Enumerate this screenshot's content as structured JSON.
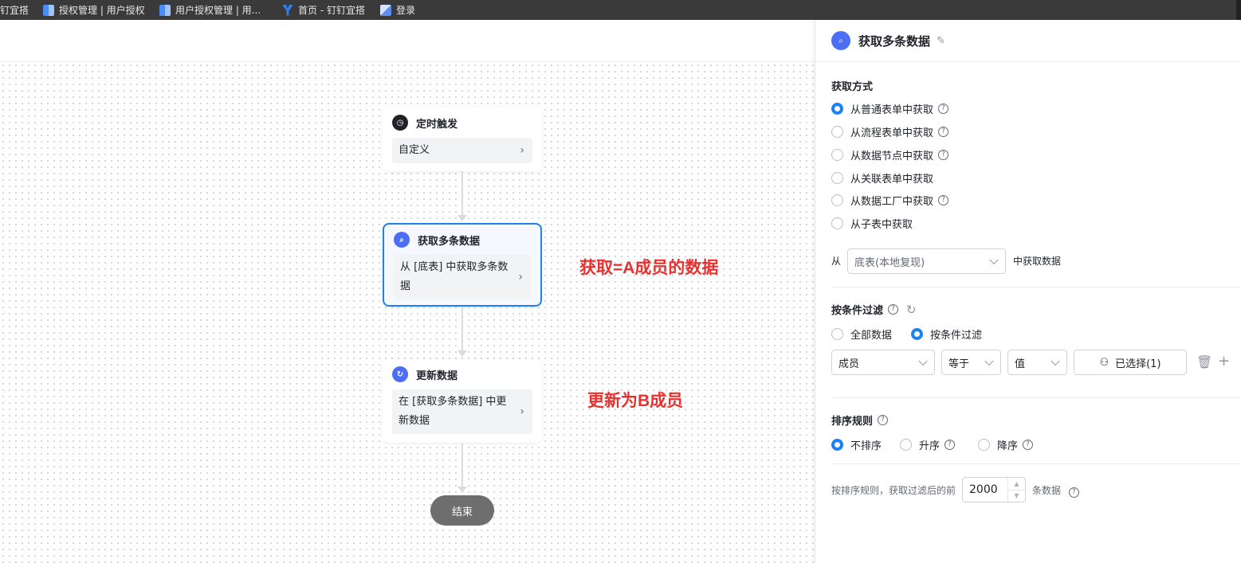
{
  "bookmarks": [
    {
      "label": "钉宜搭",
      "icon": "none"
    },
    {
      "label": "授权管理 | 用户授权",
      "icon": "grid-icon"
    },
    {
      "label": "用户授权管理 | 用...",
      "icon": "grid-icon"
    },
    {
      "label": "首页 - 钉钉宜搭",
      "icon": "yida-icon"
    },
    {
      "label": "登录",
      "icon": "app-icon"
    }
  ],
  "flow": {
    "trigger": {
      "title": "定时触发",
      "body": "自定义",
      "icon": "clock-icon"
    },
    "fetch": {
      "title": "获取多条数据",
      "body": "从 [底表] 中获取多条数据",
      "icon": "search-data-icon"
    },
    "update": {
      "title": "更新数据",
      "body": "在 [获取多条数据] 中更新数据",
      "icon": "refresh-data-icon"
    },
    "end_label": "结束"
  },
  "annotations": {
    "fetch_note": "获取=A成员的数据",
    "update_note": "更新为B成员"
  },
  "panel": {
    "title": "获取多条数据",
    "fetch_method": {
      "label": "获取方式",
      "options": [
        {
          "label": "从普通表单中获取",
          "selected": true,
          "help": true
        },
        {
          "label": "从流程表单中获取",
          "selected": false,
          "help": true
        },
        {
          "label": "从数据节点中获取",
          "selected": false,
          "help": true
        },
        {
          "label": "从关联表单中获取",
          "selected": false,
          "help": false
        },
        {
          "label": "从数据工厂中获取",
          "selected": false,
          "help": true
        },
        {
          "label": "从子表中获取",
          "selected": false,
          "help": false
        }
      ]
    },
    "source": {
      "prefix": "从",
      "value": "底表(本地复现)",
      "suffix": "中获取数据"
    },
    "filter": {
      "label": "按条件过滤",
      "options": [
        {
          "label": "全部数据",
          "selected": false
        },
        {
          "label": "按条件过滤",
          "selected": true
        }
      ],
      "field": "成员",
      "operator": "等于",
      "value_type": "值",
      "value_button": "已选择(1)"
    },
    "sort": {
      "label": "排序规则",
      "options": [
        {
          "label": "不排序",
          "selected": true,
          "help": false
        },
        {
          "label": "升序",
          "selected": false,
          "help": true
        },
        {
          "label": "降序",
          "selected": false,
          "help": true
        }
      ]
    },
    "limit": {
      "prefix": "按排序规则，获取过滤后的前",
      "value": "2000",
      "suffix": "条数据"
    }
  },
  "colors": {
    "accent": "#1f7ff5",
    "annotation": "#e8312f",
    "node_icon": "#4c6ef5"
  }
}
